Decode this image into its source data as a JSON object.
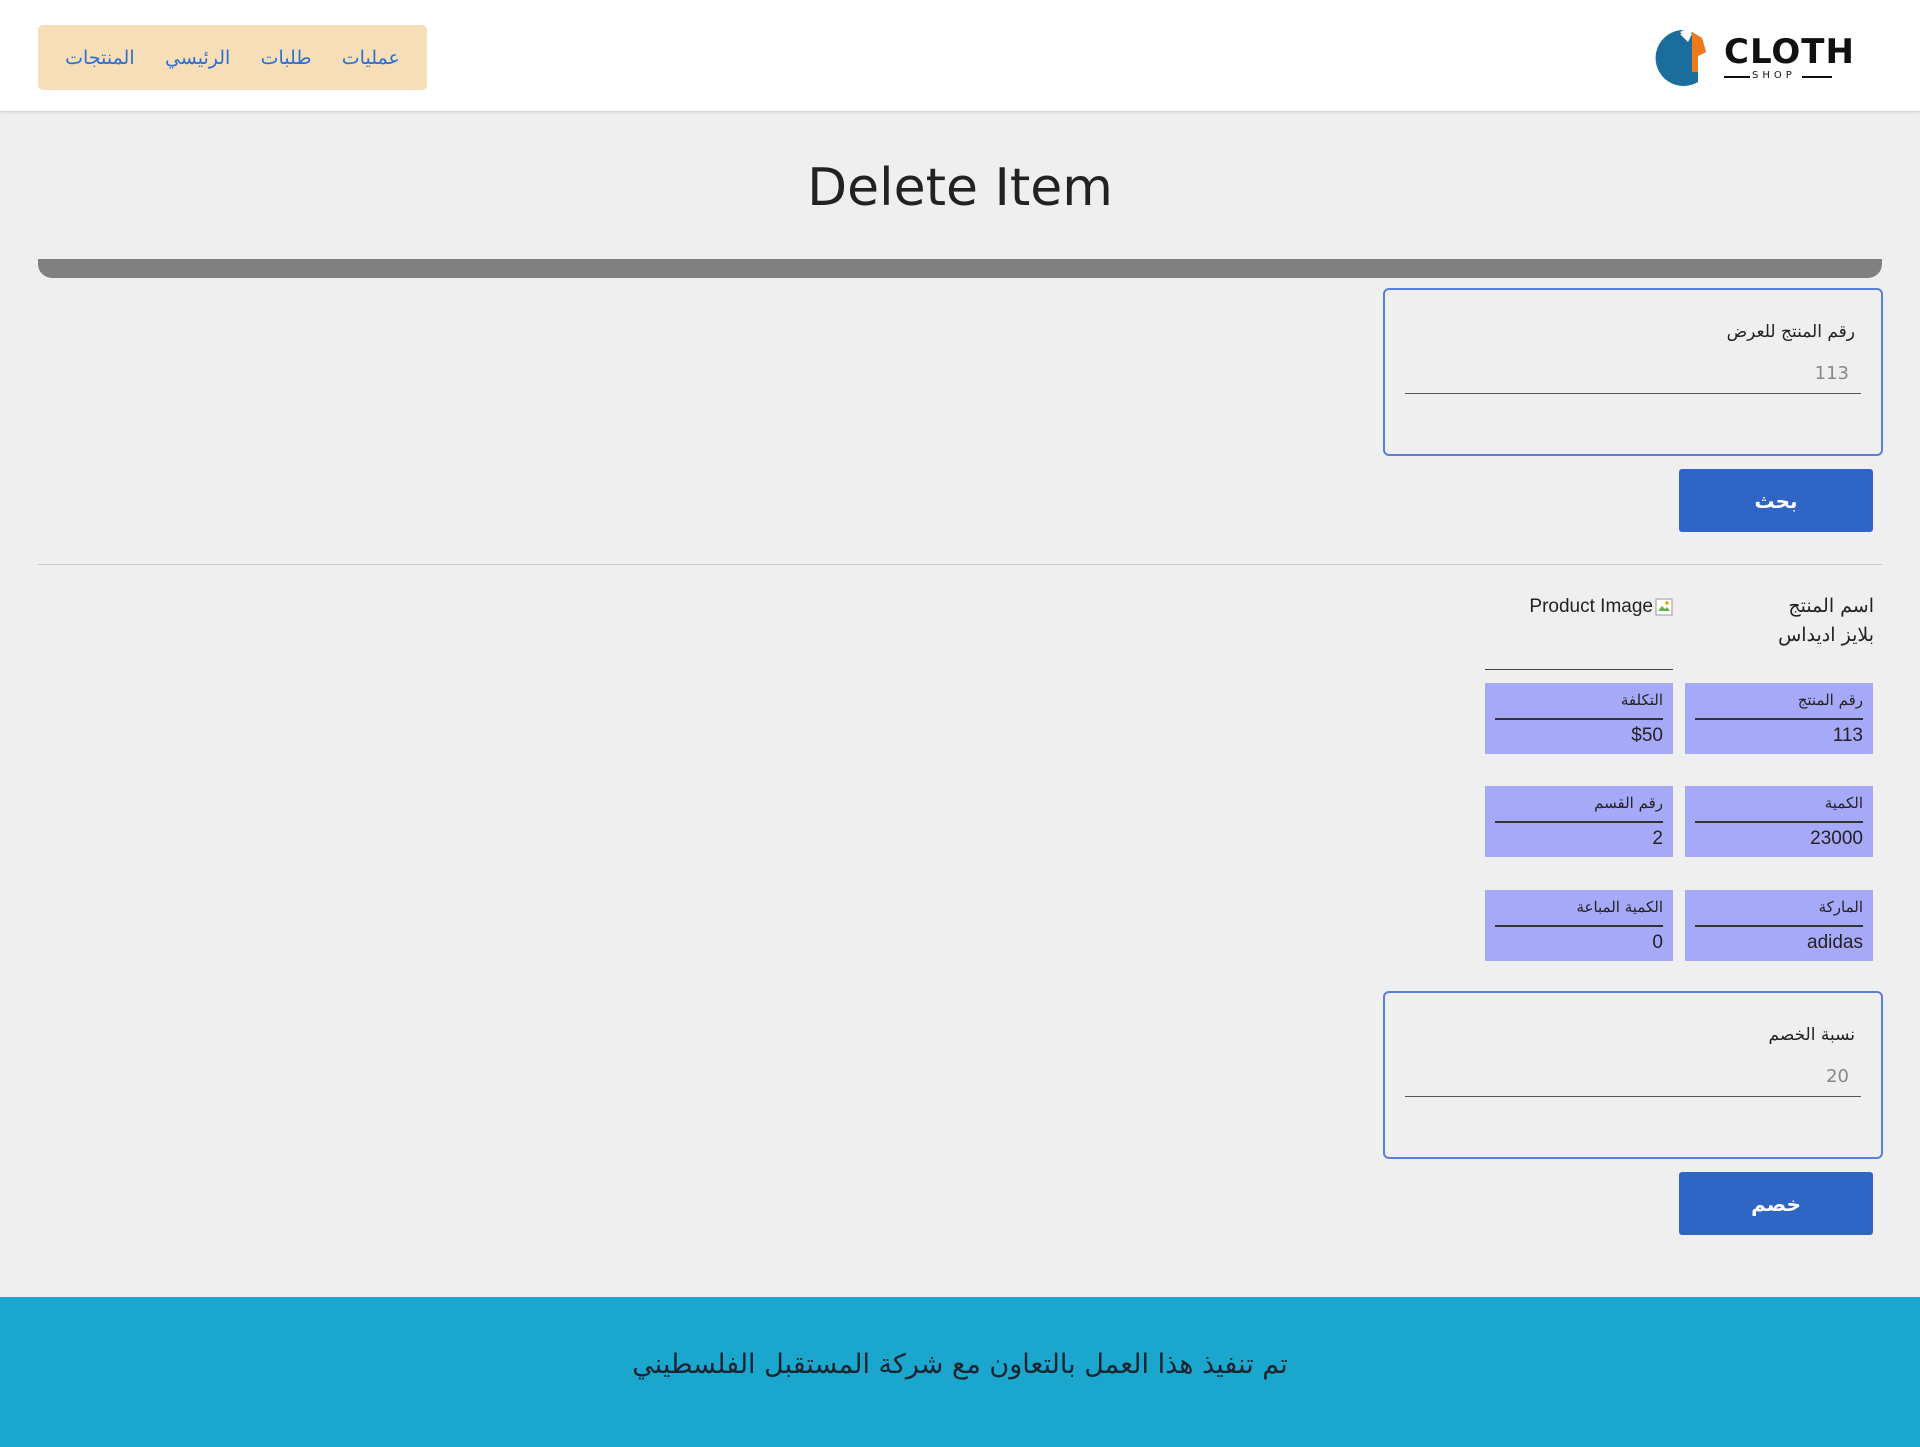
{
  "brand": {
    "logo_word": "CLOTH",
    "logo_sub": "SHOP",
    "colors": {
      "blue": "#1b6e9c",
      "orange": "#f07a1b"
    }
  },
  "nav": {
    "items": [
      {
        "label": "عمليات"
      },
      {
        "label": "طلبات"
      },
      {
        "label": "الرئيسي"
      },
      {
        "label": "المنتجات"
      }
    ]
  },
  "page": {
    "title": "Delete Item"
  },
  "search": {
    "label": "رقم المنتج للعرض",
    "value": "113",
    "button_label": "بحث"
  },
  "product": {
    "name_label": "اسم المنتج",
    "name_value": "بلايز اديداس",
    "image_alt": "Product Image",
    "fields": [
      {
        "label": "رقم المنتج",
        "value": "113"
      },
      {
        "label": "التكلفة",
        "value": "$50"
      },
      {
        "label": "الكمية",
        "value": "23000"
      },
      {
        "label": "رقم القسم",
        "value": "2"
      },
      {
        "label": "الماركة",
        "value": "adidas"
      },
      {
        "label": "الكمية المباعة",
        "value": "0"
      }
    ]
  },
  "discount": {
    "label": "نسبة الخصم",
    "value": "20",
    "button_label": "خصم"
  },
  "footer": {
    "text": "تم تنفيذ هذا العمل بالتعاون مع شركة المستقبل الفلسطيني"
  },
  "colors": {
    "nav_bg": "#f5deb8",
    "button_bg": "#2f66c6",
    "field_bg": "#a6a9f7",
    "footer_bg": "#1ba6ce",
    "card_border": "#5b7fe0"
  }
}
